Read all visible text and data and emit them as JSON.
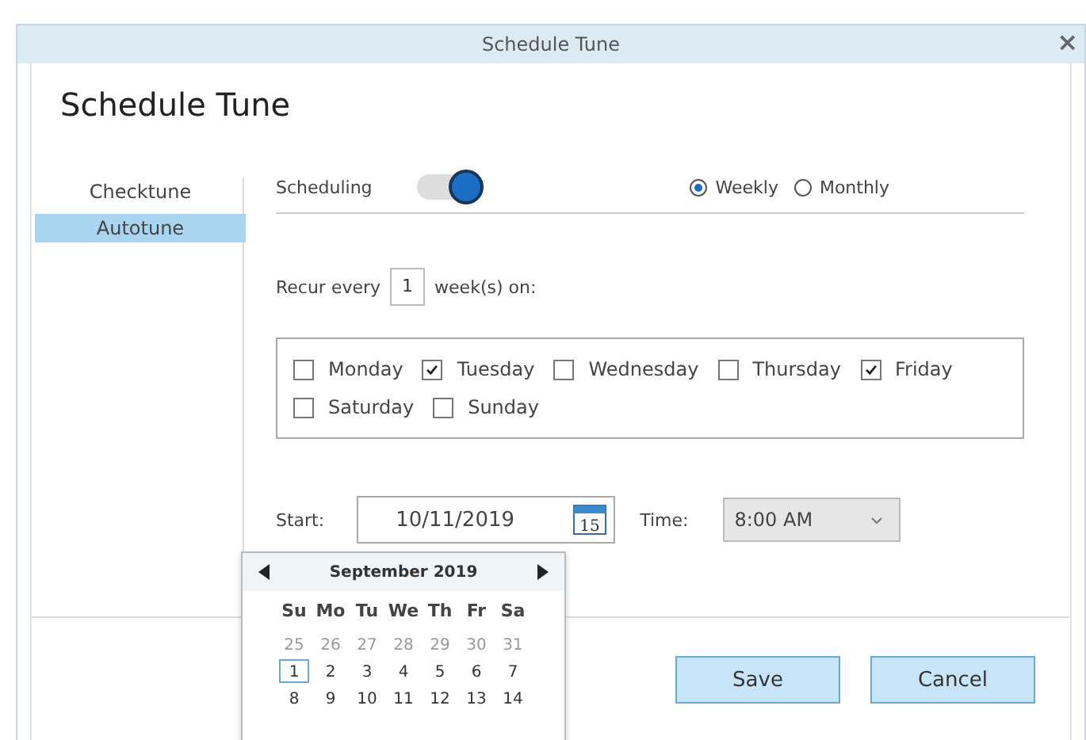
{
  "window": {
    "title": "Schedule Tune",
    "close": "×"
  },
  "heading": "Schedule Tune",
  "sidebar": {
    "items": [
      {
        "label": "Checktune",
        "selected": false
      },
      {
        "label": "Autotune",
        "selected": true
      }
    ]
  },
  "scheduling": {
    "label": "Scheduling",
    "on": true
  },
  "frequency": [
    {
      "label": "Weekly",
      "selected": true
    },
    {
      "label": "Monthly",
      "selected": false
    }
  ],
  "recur": {
    "prefix": "Recur every",
    "value": "1",
    "suffix": "week(s) on:"
  },
  "days": [
    {
      "label": "Monday",
      "checked": false
    },
    {
      "label": "Tuesday",
      "checked": true
    },
    {
      "label": "Wednesday",
      "checked": false
    },
    {
      "label": "Thursday",
      "checked": false
    },
    {
      "label": "Friday",
      "checked": true
    },
    {
      "label": "Saturday",
      "checked": false
    },
    {
      "label": "Sunday",
      "checked": false
    }
  ],
  "start": {
    "label": "Start:",
    "value": "10/11/2019",
    "icon_text": "15"
  },
  "time": {
    "label": "Time:",
    "value": "8:00 AM"
  },
  "calendar": {
    "month": "September 2019",
    "weekdays": [
      "Su",
      "Mo",
      "Tu",
      "We",
      "Th",
      "Fr",
      "Sa"
    ],
    "days": [
      {
        "label": "25",
        "muted": true,
        "selected": false
      },
      {
        "label": "26",
        "muted": true,
        "selected": false
      },
      {
        "label": "27",
        "muted": true,
        "selected": false
      },
      {
        "label": "28",
        "muted": true,
        "selected": false
      },
      {
        "label": "29",
        "muted": true,
        "selected": false
      },
      {
        "label": "30",
        "muted": true,
        "selected": false
      },
      {
        "label": "31",
        "muted": true,
        "selected": false
      },
      {
        "label": "1",
        "muted": false,
        "selected": true
      },
      {
        "label": "2",
        "muted": false,
        "selected": false
      },
      {
        "label": "3",
        "muted": false,
        "selected": false
      },
      {
        "label": "4",
        "muted": false,
        "selected": false
      },
      {
        "label": "5",
        "muted": false,
        "selected": false
      },
      {
        "label": "6",
        "muted": false,
        "selected": false
      },
      {
        "label": "7",
        "muted": false,
        "selected": false
      },
      {
        "label": "8",
        "muted": false,
        "selected": false
      },
      {
        "label": "9",
        "muted": false,
        "selected": false
      },
      {
        "label": "10",
        "muted": false,
        "selected": false
      },
      {
        "label": "11",
        "muted": false,
        "selected": false
      },
      {
        "label": "12",
        "muted": false,
        "selected": false
      },
      {
        "label": "13",
        "muted": false,
        "selected": false
      },
      {
        "label": "14",
        "muted": false,
        "selected": false
      }
    ]
  },
  "buttons": [
    "Save",
    "Cancel"
  ]
}
